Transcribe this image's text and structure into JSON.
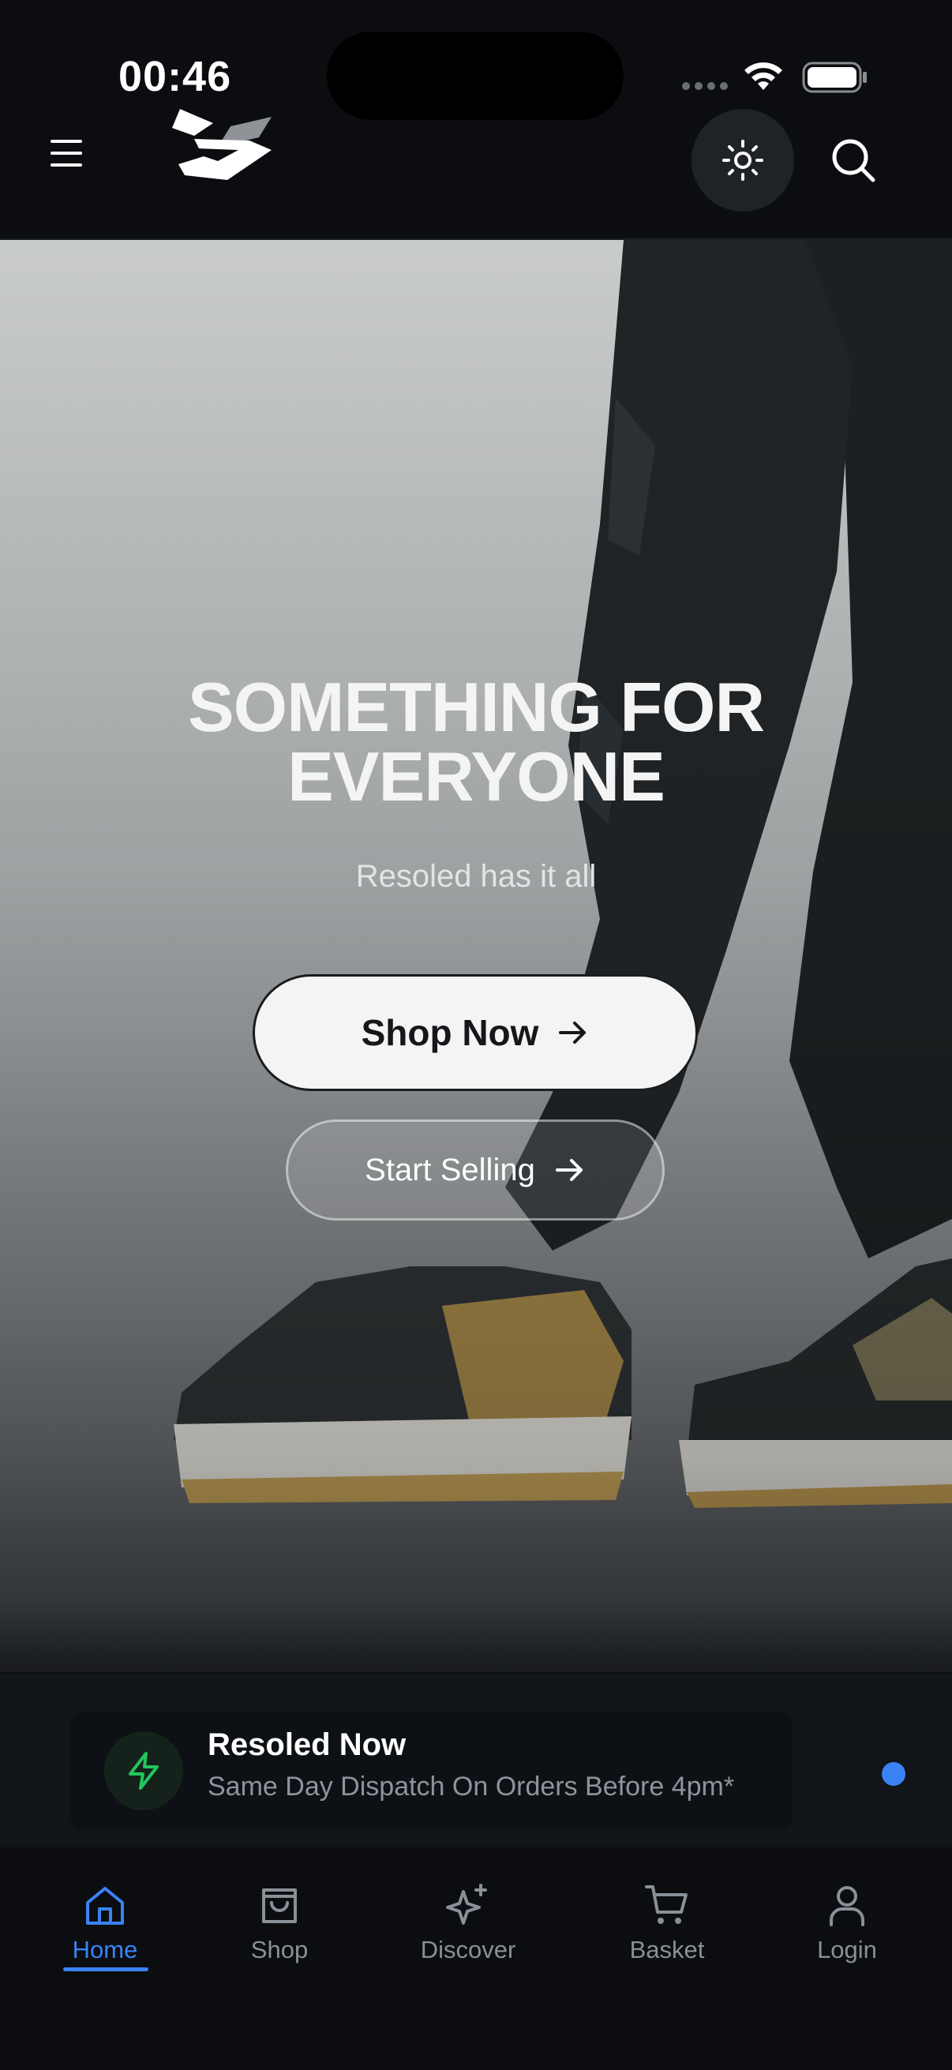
{
  "status_bar": {
    "time": "00:46"
  },
  "header": {
    "menu_icon": "hamburger-icon",
    "logo": "resoled-logo",
    "theme_icon": "sun-icon",
    "search_icon": "search-icon"
  },
  "hero": {
    "title_line1": "SOMETHING FOR",
    "title_line2": "EVERYONE",
    "subtitle": "Resoled has it all",
    "primary_button": "Shop Now",
    "secondary_button": "Start Selling"
  },
  "info": {
    "title": "Resoled Now",
    "subtitle": "Same Day Dispatch On Orders Before 4pm*",
    "icon": "bolt-icon"
  },
  "nav": {
    "items": [
      {
        "label": "Home",
        "icon": "home-icon",
        "active": true
      },
      {
        "label": "Shop",
        "icon": "bag-icon",
        "active": false
      },
      {
        "label": "Discover",
        "icon": "sparkle-icon",
        "active": false
      },
      {
        "label": "Basket",
        "icon": "cart-icon",
        "active": false
      },
      {
        "label": "Login",
        "icon": "user-icon",
        "active": false
      }
    ]
  },
  "colors": {
    "background": "#0b0d10",
    "accent": "#3b82f6",
    "bolt": "#22c55e"
  }
}
